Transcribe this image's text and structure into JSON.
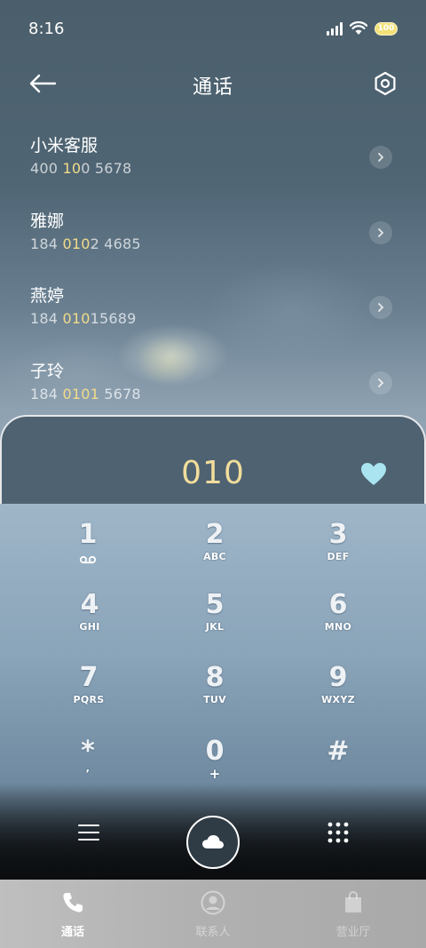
{
  "status_bar": {
    "time": "8:16",
    "battery": "100"
  },
  "header": {
    "title": "通话",
    "back_icon": "arrow-left-icon",
    "settings_icon": "hexagon-settings-icon"
  },
  "contacts": [
    {
      "name": "小米客服",
      "number_parts": [
        "400 ",
        "10",
        "0 5678"
      ]
    },
    {
      "name": "雅娜",
      "number_parts": [
        "184 ",
        "010",
        "2 4685"
      ]
    },
    {
      "name": "燕婷",
      "number_parts": [
        "184 ",
        "010",
        "15689"
      ]
    },
    {
      "name": "子玲",
      "number_parts": [
        "184 ",
        "0101",
        " 5678"
      ]
    }
  ],
  "dial": {
    "number": "010",
    "heart_icon": "heart-icon",
    "heart_color": "#a9e4f0"
  },
  "keypad": [
    {
      "digit": "1",
      "letters": "voicemail-icon"
    },
    {
      "digit": "2",
      "letters": "ABC"
    },
    {
      "digit": "3",
      "letters": "DEF"
    },
    {
      "digit": "4",
      "letters": "GHI"
    },
    {
      "digit": "5",
      "letters": "JKL"
    },
    {
      "digit": "6",
      "letters": "MNO"
    },
    {
      "digit": "7",
      "letters": "PQRS"
    },
    {
      "digit": "8",
      "letters": "TUV"
    },
    {
      "digit": "9",
      "letters": "WXYZ"
    },
    {
      "digit": "*",
      "letters": ","
    },
    {
      "digit": "0",
      "letters": "+"
    },
    {
      "digit": "#",
      "letters": ""
    }
  ],
  "actions": {
    "menu_icon": "hamburger-menu-icon",
    "call_icon": "cloud-icon",
    "grid_icon": "dialpad-grid-icon"
  },
  "bottom_nav": [
    {
      "label": "通话",
      "icon": "phone-icon",
      "active": true
    },
    {
      "label": "联系人",
      "icon": "person-icon",
      "active": false
    },
    {
      "label": "营业厅",
      "icon": "shopping-bag-icon",
      "active": false
    }
  ],
  "colors": {
    "highlight": "#f2dc8a",
    "dial_number": "#f1dd9b"
  }
}
